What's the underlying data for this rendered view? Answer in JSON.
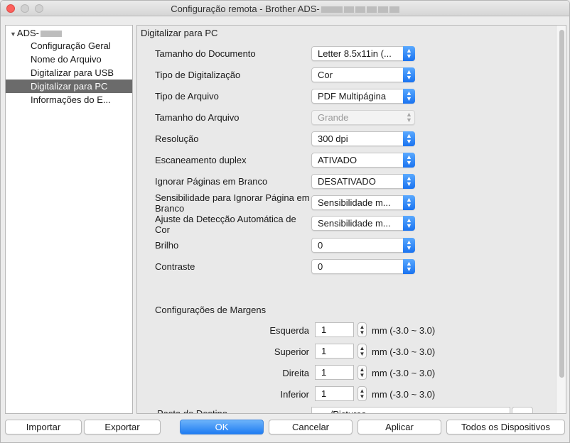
{
  "window": {
    "title_prefix": "Configuração remota - Brother ADS-"
  },
  "sidebar": {
    "root_label": "ADS-",
    "items": [
      {
        "label": "Configuração Geral"
      },
      {
        "label": "Nome do Arquivo"
      },
      {
        "label": "Digitalizar para USB"
      },
      {
        "label": "Digitalizar para PC",
        "selected": true
      },
      {
        "label": "Informações do E..."
      }
    ]
  },
  "main": {
    "section_title": "Digitalizar para PC",
    "fields": [
      {
        "label": "Tamanho do Documento",
        "value": "Letter 8.5x11in (..."
      },
      {
        "label": "Tipo de Digitalização",
        "value": "Cor"
      },
      {
        "label": "Tipo de Arquivo",
        "value": "PDF Multipágina"
      },
      {
        "label": "Tamanho do Arquivo",
        "value": "Grande",
        "disabled": true
      },
      {
        "label": "Resolução",
        "value": "300 dpi"
      },
      {
        "label": "Escaneamento duplex",
        "value": "ATIVADO"
      },
      {
        "label": "Ignorar Páginas em Branco",
        "value": "DESATIVADO"
      },
      {
        "label": "Sensibilidade para Ignorar Página em Branco",
        "value": "Sensibilidade m..."
      },
      {
        "label": "Ajuste da Detecção Automática de Cor",
        "value": "Sensibilidade m..."
      },
      {
        "label": "Brilho",
        "value": "0"
      },
      {
        "label": "Contraste",
        "value": "0"
      }
    ],
    "margins": {
      "title": "Configurações de Margens",
      "rows": [
        {
          "label": "Esquerda",
          "value": "1",
          "unit": "mm (-3.0 ~ 3.0)"
        },
        {
          "label": "Superior",
          "value": "1",
          "unit": "mm (-3.0 ~ 3.0)"
        },
        {
          "label": "Direita",
          "value": "1",
          "unit": "mm (-3.0 ~ 3.0)"
        },
        {
          "label": "Inferior",
          "value": "1",
          "unit": "mm (-3.0 ~ 3.0)"
        }
      ]
    },
    "destination": {
      "label": "Pasta de Destino",
      "value": "~/Pictures",
      "browse_label": "..."
    }
  },
  "buttons": {
    "import": "Importar",
    "export": "Exportar",
    "ok": "OK",
    "cancel": "Cancelar",
    "apply": "Aplicar",
    "all_devices": "Todos os Dispositivos"
  }
}
